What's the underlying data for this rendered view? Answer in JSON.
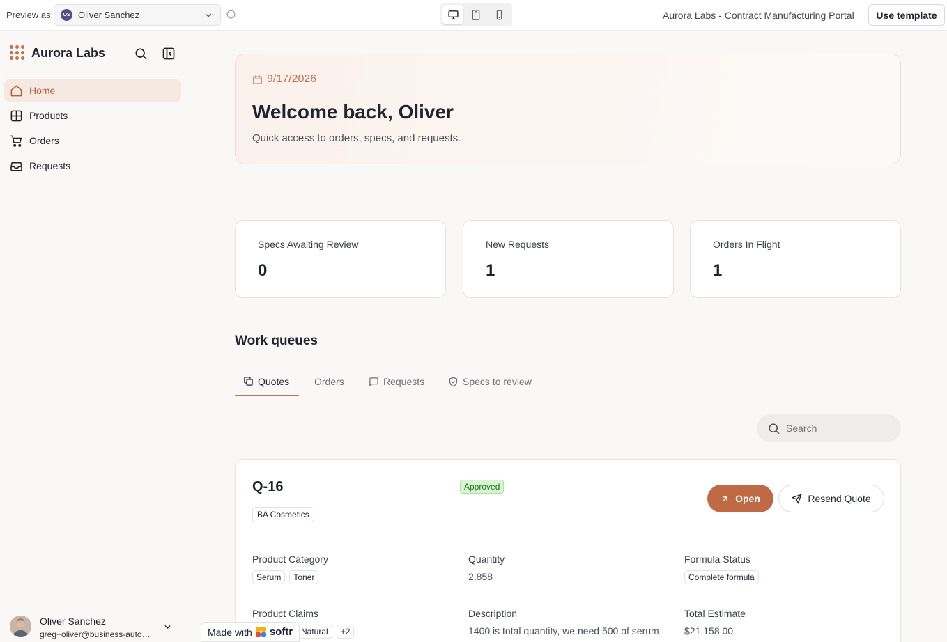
{
  "preview": {
    "label": "Preview as:",
    "user_initials": "OS",
    "user_name": "Oliver Sanchez",
    "portal_title": "Aurora Labs - Contract Manufacturing Portal",
    "use_template": "Use template"
  },
  "sidebar": {
    "brand": "Aurora Labs",
    "items": [
      {
        "label": "Home",
        "icon": "home-icon",
        "active": true
      },
      {
        "label": "Products",
        "icon": "grid-icon"
      },
      {
        "label": "Orders",
        "icon": "cart-icon"
      },
      {
        "label": "Requests",
        "icon": "inbox-icon"
      }
    ],
    "user": {
      "name": "Oliver Sanchez",
      "email": "greg+oliver@business-automated.com"
    }
  },
  "hero": {
    "date": "9/17/2026",
    "title": "Welcome back, Oliver",
    "subtitle": "Quick access to orders, specs, and requests."
  },
  "stats": [
    {
      "label": "Specs Awaiting Review",
      "value": "0"
    },
    {
      "label": "New Requests",
      "value": "1"
    },
    {
      "label": "Orders In Flight",
      "value": "1"
    }
  ],
  "work_queues": {
    "title": "Work queues",
    "tabs": [
      {
        "label": "Quotes",
        "icon": "copy-icon",
        "active": true
      },
      {
        "label": "Orders"
      },
      {
        "label": "Requests",
        "icon": "message-icon"
      },
      {
        "label": "Specs to review",
        "icon": "shield-check-icon"
      }
    ],
    "search_placeholder": "Search"
  },
  "quote": {
    "id": "Q-16",
    "status": "Approved",
    "client": "BA Cosmetics",
    "open_label": "Open",
    "resend_label": "Resend Quote",
    "fields": {
      "product_category": {
        "label": "Product Category",
        "chips": [
          "Serum",
          "Toner"
        ]
      },
      "quantity": {
        "label": "Quantity",
        "value": "2,858"
      },
      "formula_status": {
        "label": "Formula Status",
        "chips": [
          "Complete formula"
        ]
      },
      "product_claims": {
        "label": "Product Claims",
        "chips": [
          "Natural",
          "+2"
        ]
      },
      "description": {
        "label": "Description",
        "value": "1400 is total quantity, we need 500 of serum"
      },
      "total_estimate": {
        "label": "Total Estimate",
        "value": "$21,158.00"
      }
    }
  },
  "footer_badge": {
    "prefix": "Made with",
    "brand": "softr"
  },
  "colors": {
    "accent": "#c0714e",
    "approved_bg": "#d7f5d1",
    "open_button": "#bf6a45"
  }
}
